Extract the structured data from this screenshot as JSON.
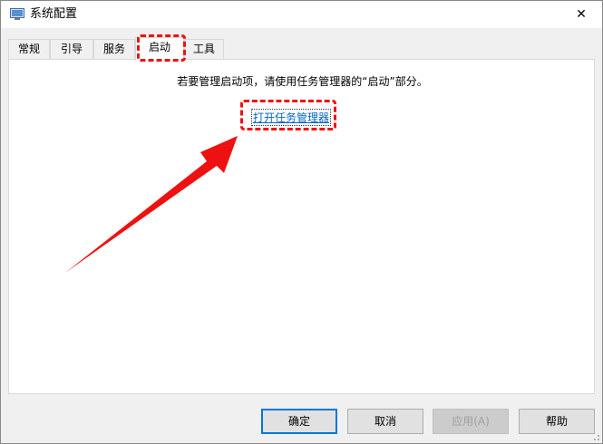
{
  "window": {
    "title": "系统配置",
    "close_glyph": "✕"
  },
  "tabs": [
    {
      "label": "常规",
      "active": false
    },
    {
      "label": "引导",
      "active": false
    },
    {
      "label": "服务",
      "active": false
    },
    {
      "label": "启动",
      "active": true
    },
    {
      "label": "工具",
      "active": false
    }
  ],
  "panel": {
    "info_text": "若要管理启动项，请使用任务管理器的“启动”部分。",
    "link_text": "打开任务管理器"
  },
  "buttons": {
    "ok": "确定",
    "cancel": "取消",
    "apply": "应用(A)",
    "help": "帮助"
  },
  "colors": {
    "annotation": "#ee1111",
    "link": "#0066cc",
    "accent": "#0078d7"
  },
  "icons": {
    "app": "system-config-icon",
    "close": "close-icon",
    "annotation_arrow": "annotation-arrow"
  }
}
